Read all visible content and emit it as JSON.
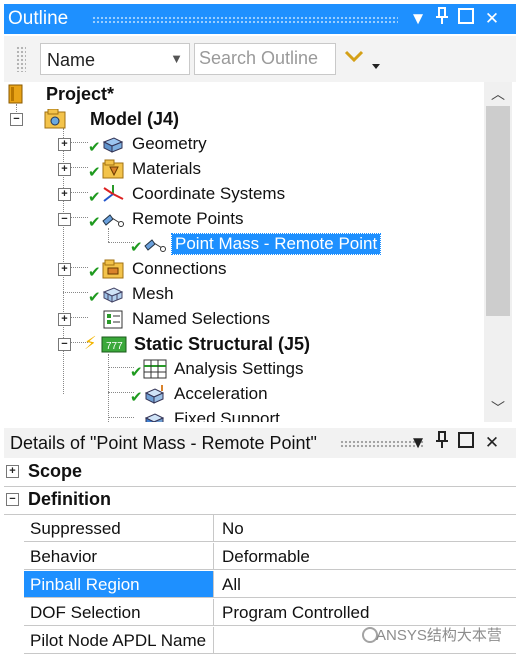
{
  "outline": {
    "title": "Outline",
    "toolbar": {
      "sort_select": "Name",
      "search_placeholder": "Search Outline"
    },
    "tree": {
      "project": "Project*",
      "model": "Model (J4)",
      "geometry": "Geometry",
      "materials": "Materials",
      "coordinate_systems": "Coordinate Systems",
      "remote_points": "Remote Points",
      "point_mass": "Point Mass - Remote Point",
      "connections": "Connections",
      "mesh": "Mesh",
      "named_selections": "Named Selections",
      "static_structural": "Static Structural (J5)",
      "analysis_settings": "Analysis Settings",
      "acceleration": "Acceleration",
      "fixed_support": "Fixed Support"
    }
  },
  "details": {
    "title": "Details of \"Point Mass - Remote Point\"",
    "groups": {
      "scope": "Scope",
      "definition": "Definition"
    },
    "rows": [
      {
        "name": "Suppressed",
        "value": "No"
      },
      {
        "name": "Behavior",
        "value": "Deformable"
      },
      {
        "name": "Pinball Region",
        "value": "All"
      },
      {
        "name": "DOF Selection",
        "value": "Program Controlled"
      },
      {
        "name": "Pilot Node APDL Name",
        "value": ""
      }
    ]
  },
  "watermark": "ANSYS结构大本营",
  "colors": {
    "accent": "#1e90ff",
    "check": "#1f9a1f"
  }
}
